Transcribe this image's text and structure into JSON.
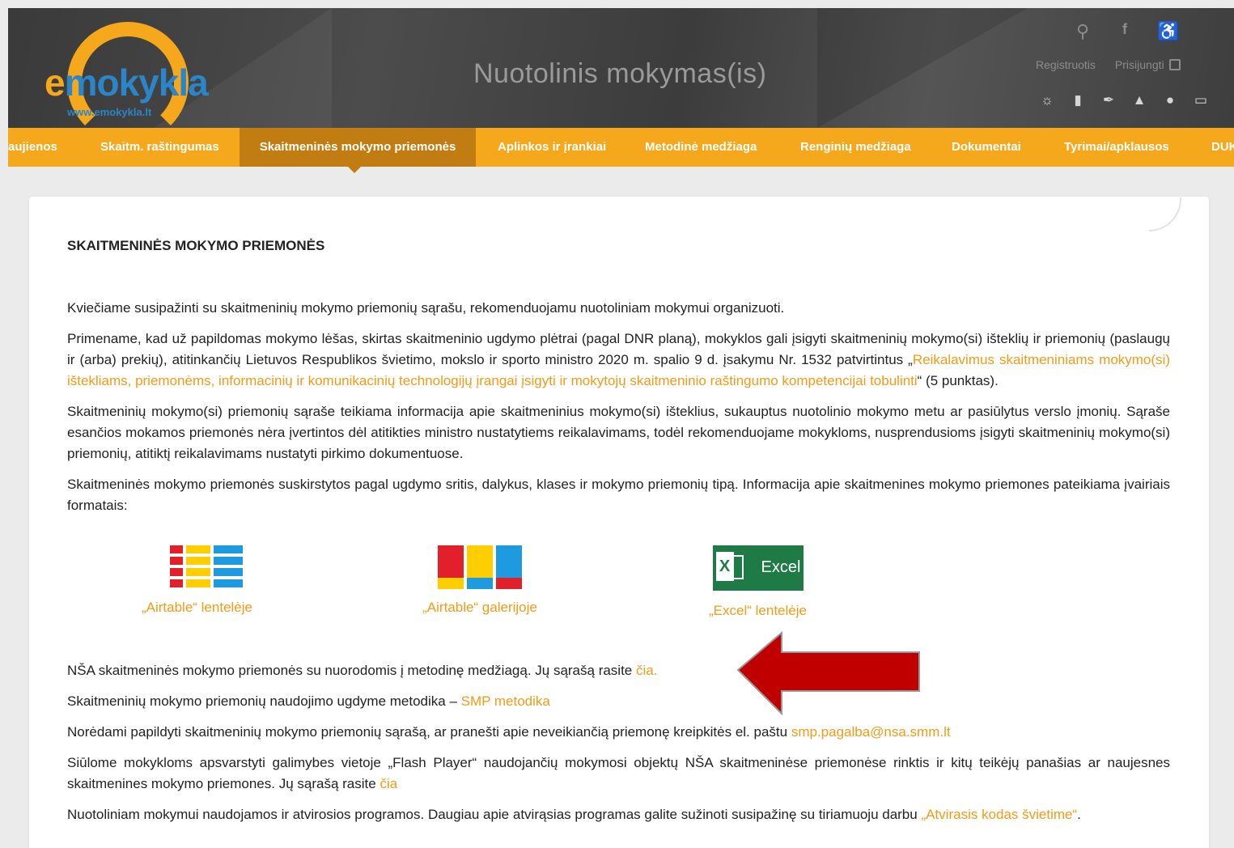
{
  "header": {
    "logo_letter": "e",
    "logo_rest": "mokykla",
    "logo_url": "www.emokykla.lt",
    "site_title": "Nuotolinis mokymas(is)",
    "register_label": "Registruotis",
    "login_label": "Prisijungti",
    "top_icons": [
      "search-icon",
      "facebook-icon",
      "accessibility-icon"
    ],
    "category_icons": [
      "sun-icon",
      "book-icon",
      "pen-icon",
      "graduation-cap-icon",
      "reader-icon",
      "screen-icon"
    ]
  },
  "nav": {
    "items": [
      {
        "label": "aujienos"
      },
      {
        "label": "Skaitm. raštingumas"
      },
      {
        "label": "Skaitmeninės mokymo priemonės",
        "active": true
      },
      {
        "label": "Aplinkos ir įrankiai"
      },
      {
        "label": "Metodinė medžiaga"
      },
      {
        "label": "Renginių medžiaga"
      },
      {
        "label": "Dokumentai"
      },
      {
        "label": "Tyrimai/apklausos"
      },
      {
        "label": "DUK"
      }
    ]
  },
  "content": {
    "heading": "SKAITMENINĖS MOKYMO PRIEMONĖS",
    "p1": "Kviečiame susipažinti su skaitmeninių mokymo priemonių sąrašu, rekomenduojamu nuotoliniam mokymui organizuoti.",
    "p2_before": "Primename, kad už papildomas mokymo lėšas, skirtas skaitmeninio ugdymo plėtrai (pagal DNR planą), mokyklos gali įsigyti skaitmeninių mokymo(si) išteklių ir priemonių (paslaugų ir (arba) prekių), atitinkančių Lietuvos Respublikos švietimo, mokslo ir sporto ministro 2020 m. spalio 9 d. įsakymu Nr. 1532 patvirtintus „",
    "p2_link": "Reikalavimus skaitmeniniams mokymo(si) ištekliams, priemonėms, informacinių ir komunikacinių technologijų įrangai įsigyti ir mokytojų skaitmeninio raštingumo kompetencijai tobulinti",
    "p2_after": "“ (5 punktas).",
    "p3": "Skaitmeninių mokymo(si) priemonių sąraše teikiama informacija apie skaitmeninius mokymo(si) išteklius, sukauptus nuotolinio mokymo metu ar pasiūlytus verslo įmonių. Sąraše esančios mokamos priemonės nėra įvertintos dėl atitikties ministro nustatytiems reikalavimams, todėl rekomenduojame mokykloms, nusprendusioms įsigyti skaitmeninių mokymo(si) priemonių, atitiktį reikalavimams nustatyti pirkimo dokumentuose.",
    "p4": "Skaitmeninės mokymo priemonės suskirstytos pagal ugdymo sritis, dalykus, klases ir mokymo priemonių tipą. Informacija apie skaitmenines mokymo priemones pateikiama įvairiais formatais:",
    "formats": [
      {
        "label": "„Airtable“ lentelėje",
        "icon": "airtable-grid-icon"
      },
      {
        "label": "„Airtable“ galerijoje",
        "icon": "airtable-gallery-icon"
      },
      {
        "label": "„Excel“ lentelėje",
        "icon": "excel-icon",
        "icon_text": "Excel",
        "icon_letter": "X"
      }
    ],
    "p5_before": "NŠA skaitmeninės mokymo priemonės su nuorodomis į metodinę medžiagą. Jų sąrašą rasite ",
    "p5_link": "čia.",
    "p6_before": "Skaitmeninių mokymo priemonių naudojimo ugdyme metodika – ",
    "p6_link": "SMP metodika",
    "p7_before": "Norėdami papildyti skaitmeninių mokymo priemonių sąrašą, ar pranešti apie neveikiančią priemonę kreipkitės el. paštu ",
    "p7_link": "smp.pagalba@nsa.smm.lt",
    "p8_before": "Siūlome mokykloms apsvarstyti galimybes vietoje „Flash Player“ naudojančių mokymosi objektų NŠA skaitmeninėse priemonėse rinktis ir kitų teikėjų panašias ar naujesnes skaitmenines mokymo priemones. Jų sąrašą rasite ",
    "p8_link": "čia",
    "p9_before": "Nuotoliniam mokymui naudojamos ir atvirosios programos. Daugiau apie atvirąsias programas galite sužinoti susipažinę su tiriamuoju darbu ",
    "p9_link": "„Atvirasis kodas švietime“",
    "p9_after": "."
  },
  "colors": {
    "brand_orange": "#f6a81c",
    "link_orange": "#f39a17",
    "nav_active": "#c27d12",
    "annotation_arrow": "#c00000"
  }
}
